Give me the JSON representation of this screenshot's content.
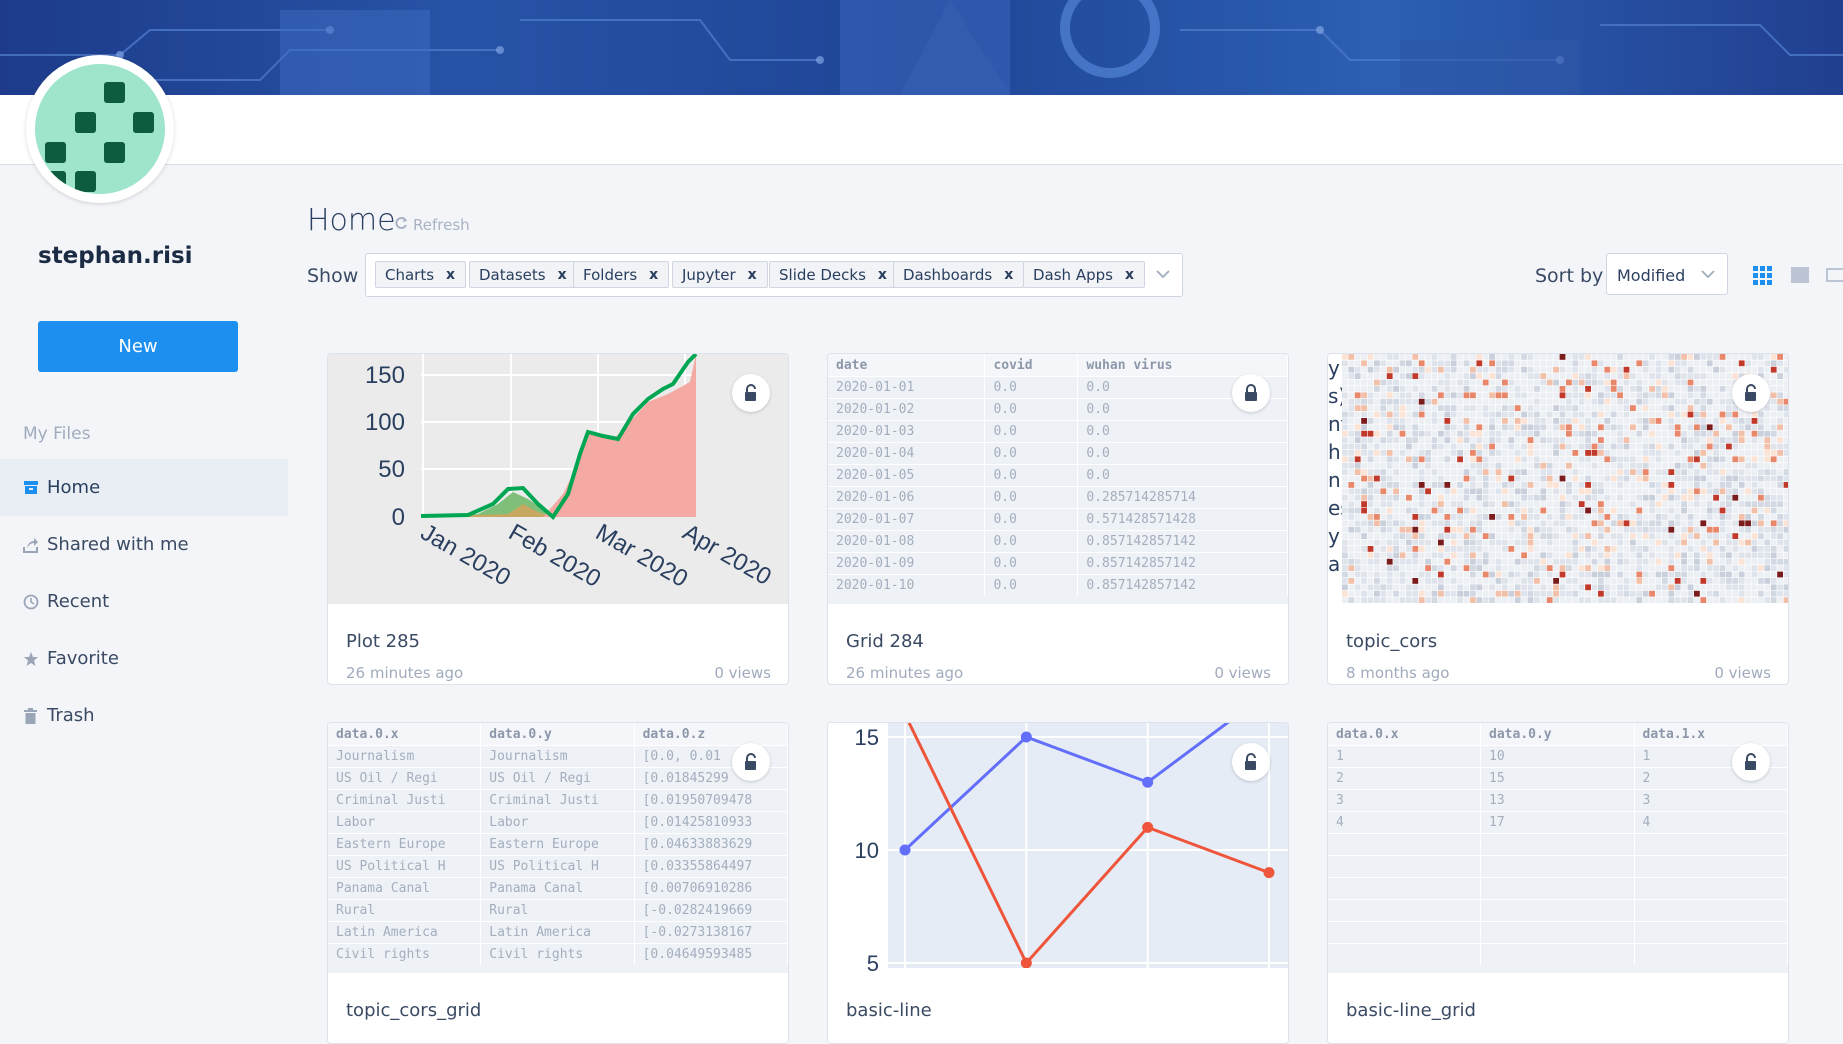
{
  "user": {
    "name": "stephan.risi"
  },
  "sidebar": {
    "new_label": "New",
    "section_label": "My Files",
    "items": [
      {
        "label": "Home",
        "icon": "home-icon"
      },
      {
        "label": "Shared with me",
        "icon": "shared-icon"
      },
      {
        "label": "Recent",
        "icon": "clock-icon"
      },
      {
        "label": "Favorite",
        "icon": "star-icon"
      },
      {
        "label": "Trash",
        "icon": "trash-icon"
      }
    ]
  },
  "header": {
    "title": "Home",
    "refresh_label": "Refresh"
  },
  "filters": {
    "show_label": "Show",
    "chips": [
      "Charts",
      "Datasets",
      "Folders",
      "Jupyter",
      "Slide Decks",
      "Dashboards",
      "Dash Apps"
    ],
    "chip_remove": "x"
  },
  "sort": {
    "label": "Sort by",
    "value": "Modified"
  },
  "colors": {
    "accent": "#1c8ff0",
    "avatar_bg": "#9ee5cb"
  },
  "cards": [
    {
      "title": "Plot 285",
      "time": "26 minutes ago",
      "views": "0 views",
      "locked": false
    },
    {
      "title": "Grid 284",
      "time": "26 minutes ago",
      "views": "0 views",
      "locked": true
    },
    {
      "title": "topic_cors",
      "time": "8 months ago",
      "views": "0 views",
      "locked": false
    },
    {
      "title": "topic_cors_grid",
      "locked": false
    },
    {
      "title": "basic-line",
      "locked": false
    },
    {
      "title": "basic-line_grid",
      "locked": false
    }
  ],
  "thumbs": {
    "plot285": {
      "yticks": [
        "150",
        "100",
        "50",
        "0"
      ],
      "xticks": [
        "Jan 2020",
        "Feb 2020",
        "Mar 2020",
        "Apr 2020"
      ]
    },
    "grid284": {
      "headers": [
        "date",
        "covid",
        "wuhan virus"
      ],
      "rows": [
        [
          "2020-01-01",
          "0.0",
          "0.0"
        ],
        [
          "2020-01-02",
          "0.0",
          "0.0"
        ],
        [
          "2020-01-03",
          "0.0",
          "0.0"
        ],
        [
          "2020-01-04",
          "0.0",
          "0.0"
        ],
        [
          "2020-01-05",
          "0.0",
          "0.0"
        ],
        [
          "2020-01-06",
          "0.0",
          "0.285714285714"
        ],
        [
          "2020-01-07",
          "0.0",
          "0.571428571428"
        ],
        [
          "2020-01-08",
          "0.0",
          "0.857142857142"
        ],
        [
          "2020-01-09",
          "0.0",
          "0.857142857142"
        ],
        [
          "2020-01-10",
          "0.0",
          "0.857142857142"
        ]
      ]
    },
    "topiccors": {
      "side_letters": [
        "y",
        "s)",
        "nt",
        "h",
        "n",
        "es",
        "y",
        "a"
      ]
    },
    "topiccorsgrid": {
      "headers": [
        "data.0.x",
        "data.0.y",
        "data.0.z"
      ],
      "rows": [
        [
          "Journalism",
          "Journalism",
          "[0.0, 0.01"
        ],
        [
          "US Oil / Regi",
          "US Oil / Regi",
          "[0.01845299"
        ],
        [
          "Criminal Justi",
          "Criminal Justi",
          "[0.01950709478"
        ],
        [
          "Labor",
          "Labor",
          "[0.01425810933"
        ],
        [
          "Eastern Europe",
          "Eastern Europe",
          "[0.04633883629"
        ],
        [
          "US Political H",
          "US Political H",
          "[0.03355864497"
        ],
        [
          "Panama Canal",
          "Panama Canal",
          "[0.00706910286"
        ],
        [
          "Rural",
          "Rural",
          "[-0.0282419669"
        ],
        [
          "Latin America",
          "Latin America",
          "[-0.0273138167"
        ],
        [
          "Civil rights",
          "Civil rights",
          "[0.04649593485"
        ]
      ]
    },
    "basicline": {
      "yticks": [
        "15",
        "10",
        "5"
      ]
    },
    "basiclinegrid": {
      "headers": [
        "data.0.x",
        "data.0.y",
        "data.1.x"
      ],
      "rows": [
        [
          "1",
          "10",
          "1"
        ],
        [
          "2",
          "15",
          "2"
        ],
        [
          "3",
          "13",
          "3"
        ],
        [
          "4",
          "17",
          "4"
        ],
        [
          "",
          "",
          ""
        ],
        [
          "",
          "",
          ""
        ],
        [
          "",
          "",
          ""
        ],
        [
          "",
          "",
          ""
        ],
        [
          "",
          "",
          ""
        ],
        [
          "",
          "",
          ""
        ]
      ]
    }
  },
  "chart_data": [
    {
      "type": "line",
      "x": [
        1,
        2,
        3,
        4
      ],
      "series": [
        {
          "values": [
            10,
            15,
            13,
            17
          ],
          "color": "#636efa"
        },
        {
          "values": [
            16,
            5,
            11,
            9
          ],
          "color": "#ef553b"
        }
      ],
      "ylim": [
        4,
        15.5
      ]
    }
  ]
}
